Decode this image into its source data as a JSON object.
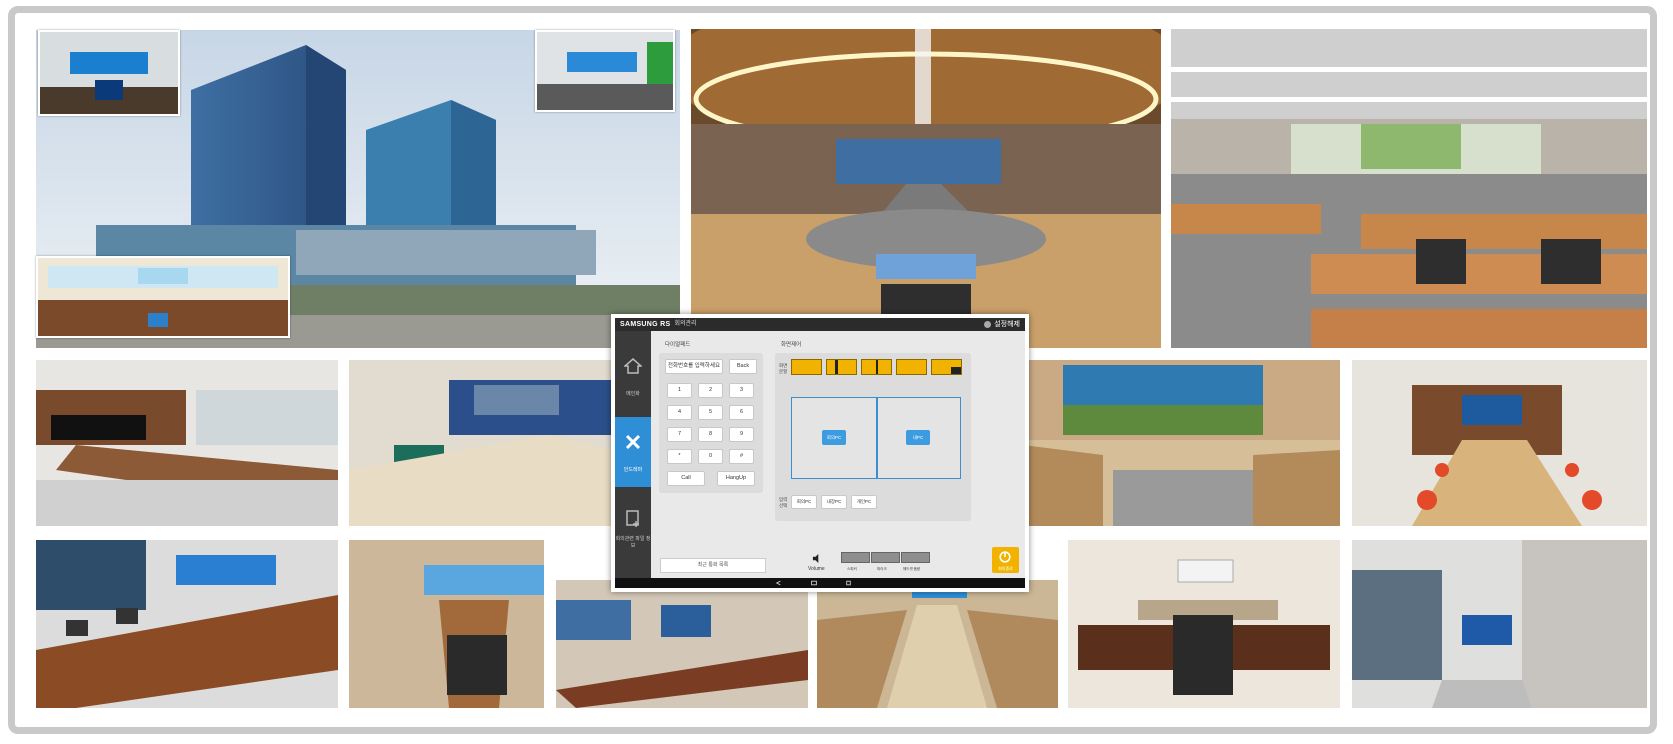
{
  "tablet_ui": {
    "brand": "SAMSUNG RS",
    "brand_sub": "회의관리",
    "top_right": "설정해제",
    "sidebar": [
      {
        "label": "메인화",
        "icon": "home-icon"
      },
      {
        "label": "안드레마",
        "icon": "tools-icon"
      },
      {
        "label": "회의관련 파일 정보",
        "icon": "document-add-icon"
      }
    ],
    "keypad_panel_title": "다이얼패드",
    "keypad_input_placeholder": "전화번호를 입력하세요",
    "keypad_back": "Back",
    "keypad_keys": [
      "1",
      "2",
      "3",
      "4",
      "5",
      "6",
      "7",
      "8",
      "9",
      "*",
      "0",
      "#"
    ],
    "keypad_call": "Call",
    "keypad_hangup": "HangUp",
    "control_panel_title": "화면제어",
    "layout_label": "화면분할",
    "source_left": "회의PC",
    "source_right": "내PC",
    "source_label": "입력선택",
    "source_options": [
      "회의PC",
      "내장PC",
      "개인PC"
    ],
    "recent_call_button": "최근 통화 목록",
    "volume_label": "Volume",
    "volume_buttons": [
      "스피커",
      "마이크",
      "헤드셋 음량"
    ],
    "power_label": "회의종료"
  },
  "colors": {
    "accent_blue": "#2f8fd6",
    "accent_yellow": "#f2b300",
    "frame_gray": "#c9c9c9"
  }
}
